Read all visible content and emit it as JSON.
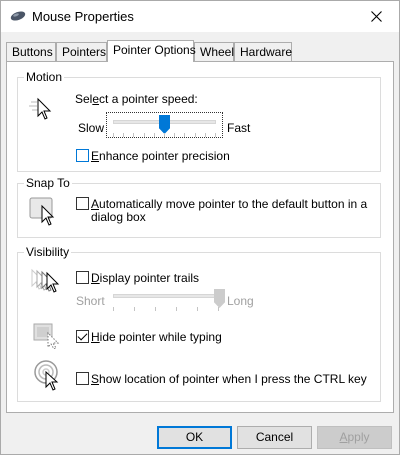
{
  "window": {
    "title": "Mouse Properties",
    "icons": {
      "app": "mouse-icon",
      "close": "close-icon"
    }
  },
  "tabs": [
    {
      "label": "Buttons",
      "selected": false
    },
    {
      "label": "Pointers",
      "selected": false
    },
    {
      "label": "Pointer Options",
      "selected": true
    },
    {
      "label": "Wheel",
      "selected": false
    },
    {
      "label": "Hardware",
      "selected": false
    }
  ],
  "motion": {
    "group_label": "Motion",
    "prompt_pre": "Sel",
    "prompt_u": "e",
    "prompt_post": "ct a pointer speed:",
    "slow": "Slow",
    "fast": "Fast",
    "speed_level": 0.5,
    "enhance": {
      "pre": "",
      "u": "E",
      "post": "nhance pointer precision",
      "checked": false
    }
  },
  "snap_to": {
    "group_label": "Snap To",
    "option": {
      "pre": "",
      "u": "A",
      "post": "utomatically move pointer to the default button in a",
      "line2": "dialog box",
      "checked": false
    }
  },
  "visibility": {
    "group_label": "Visibility",
    "trails": {
      "pre": "",
      "u": "D",
      "post": "isplay pointer trails",
      "checked": false
    },
    "short": "Short",
    "long": "Long",
    "trail_level": 1.0,
    "hide": {
      "pre": "",
      "u": "H",
      "post": "ide pointer while typing",
      "checked": true
    },
    "show": {
      "pre": "",
      "u": "S",
      "post": "how location of pointer when I press the CTRL key",
      "checked": false
    }
  },
  "buttons": {
    "ok": "OK",
    "cancel": "Cancel",
    "apply_u": "A",
    "apply_post": "pply"
  },
  "colors": {
    "accent": "#0078d7",
    "panel": "#ffffff",
    "chrome": "#f0f0f0"
  }
}
